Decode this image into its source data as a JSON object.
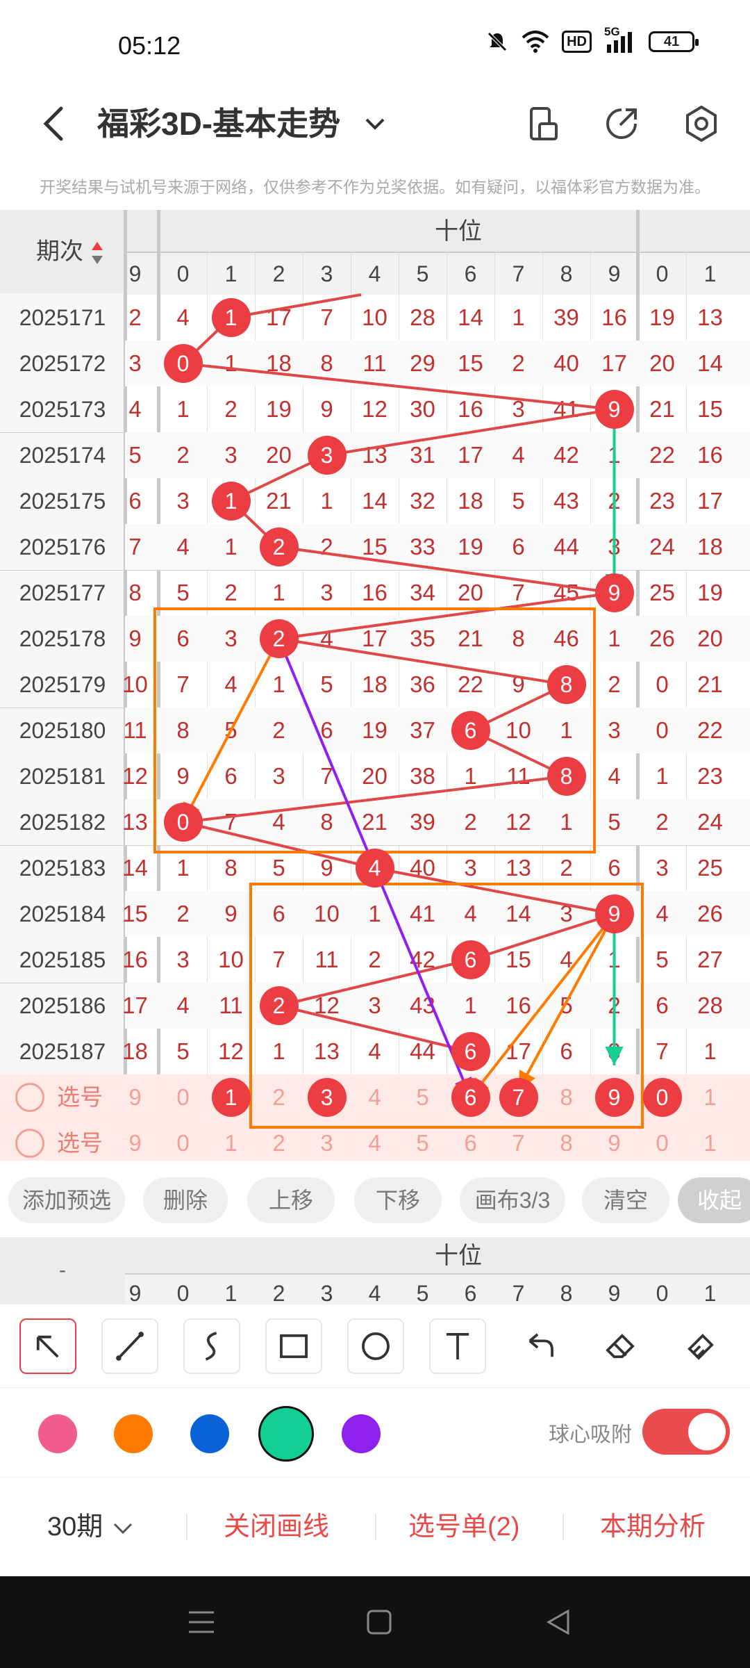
{
  "status": {
    "time": "05:12",
    "battery": "41",
    "hd": "HD",
    "signal": "5G"
  },
  "appbar": {
    "title": "福彩3D-基本走势"
  },
  "notice": "开奖结果与试机号来源于网络，仅供参考不作为兑奖依据。如有疑问，以福体彩官方数据为准。",
  "chart": {
    "period_header": "期次",
    "group_label": "十位",
    "head_digits": [
      "9",
      "0",
      "1",
      "2",
      "3",
      "4",
      "5",
      "6",
      "7",
      "8",
      "9",
      "0",
      "1"
    ],
    "rows": [
      {
        "period": "2025171",
        "cells": [
          "2",
          "4",
          "1",
          "17",
          "7",
          "10",
          "28",
          "14",
          "1",
          "39",
          "16",
          "19",
          "13"
        ],
        "ball": 2
      },
      {
        "period": "2025172",
        "cells": [
          "3",
          "0",
          "1",
          "18",
          "8",
          "11",
          "29",
          "15",
          "2",
          "40",
          "17",
          "20",
          "14"
        ],
        "ball": 1
      },
      {
        "period": "2025173",
        "cells": [
          "4",
          "1",
          "2",
          "19",
          "9",
          "12",
          "30",
          "16",
          "3",
          "41",
          "9",
          "21",
          "15"
        ],
        "ball": 10
      },
      {
        "period": "2025174",
        "cells": [
          "5",
          "2",
          "3",
          "20",
          "3",
          "13",
          "31",
          "17",
          "4",
          "42",
          "1",
          "22",
          "16"
        ],
        "ball": 4
      },
      {
        "period": "2025175",
        "cells": [
          "6",
          "3",
          "1",
          "21",
          "1",
          "14",
          "32",
          "18",
          "5",
          "43",
          "2",
          "23",
          "17"
        ],
        "ball": 2
      },
      {
        "period": "2025176",
        "cells": [
          "7",
          "4",
          "1",
          "2",
          "2",
          "15",
          "33",
          "19",
          "6",
          "44",
          "3",
          "24",
          "18"
        ],
        "ball": 3
      },
      {
        "period": "2025177",
        "cells": [
          "8",
          "5",
          "2",
          "1",
          "3",
          "16",
          "34",
          "20",
          "7",
          "45",
          "9",
          "25",
          "19"
        ],
        "ball": 10
      },
      {
        "period": "2025178",
        "cells": [
          "9",
          "6",
          "3",
          "2",
          "4",
          "17",
          "35",
          "21",
          "8",
          "46",
          "1",
          "26",
          "20"
        ],
        "ball": 3
      },
      {
        "period": "2025179",
        "cells": [
          "10",
          "7",
          "4",
          "1",
          "5",
          "18",
          "36",
          "22",
          "9",
          "8",
          "2",
          "0",
          "21"
        ],
        "ball": 9
      },
      {
        "period": "2025180",
        "cells": [
          "11",
          "8",
          "5",
          "2",
          "6",
          "19",
          "37",
          "6",
          "10",
          "1",
          "3",
          "0",
          "22"
        ],
        "ball": 7
      },
      {
        "period": "2025181",
        "cells": [
          "12",
          "9",
          "6",
          "3",
          "7",
          "20",
          "38",
          "1",
          "11",
          "8",
          "4",
          "1",
          "23"
        ],
        "ball": 9
      },
      {
        "period": "2025182",
        "cells": [
          "13",
          "0",
          "7",
          "4",
          "8",
          "21",
          "39",
          "2",
          "12",
          "1",
          "5",
          "2",
          "24"
        ],
        "ball": 1
      },
      {
        "period": "2025183",
        "cells": [
          "14",
          "1",
          "8",
          "5",
          "9",
          "4",
          "40",
          "3",
          "13",
          "2",
          "6",
          "3",
          "25"
        ],
        "ball": 5
      },
      {
        "period": "2025184",
        "cells": [
          "15",
          "2",
          "9",
          "6",
          "10",
          "1",
          "41",
          "4",
          "14",
          "3",
          "9",
          "4",
          "26"
        ],
        "ball": 10
      },
      {
        "period": "2025185",
        "cells": [
          "16",
          "3",
          "10",
          "7",
          "11",
          "2",
          "42",
          "6",
          "15",
          "4",
          "1",
          "5",
          "27"
        ],
        "ball": 7
      },
      {
        "period": "2025186",
        "cells": [
          "17",
          "4",
          "11",
          "2",
          "12",
          "3",
          "43",
          "1",
          "16",
          "5",
          "2",
          "6",
          "28"
        ],
        "ball": 3
      },
      {
        "period": "2025187",
        "cells": [
          "18",
          "5",
          "12",
          "1",
          "13",
          "4",
          "44",
          "6",
          "17",
          "6",
          "3",
          "7",
          "1"
        ],
        "ball": 7
      }
    ],
    "select_rows": [
      {
        "label": "选号",
        "cells": [
          "9",
          "0",
          "1",
          "2",
          "3",
          "4",
          "5",
          "6",
          "7",
          "8",
          "9",
          "0",
          "1"
        ]
      },
      {
        "label": "选号",
        "cells": [
          "9",
          "0",
          "1",
          "2",
          "3",
          "4",
          "5",
          "6",
          "7",
          "8",
          "9",
          "0",
          "1"
        ]
      }
    ]
  },
  "pills": [
    "添加预选",
    "删除",
    "上移",
    "下移",
    "画布3/3",
    "清空",
    "收起"
  ],
  "tool_icons": [
    "cursor-arrow-icon",
    "line-icon",
    "freehand-icon",
    "rectangle-icon",
    "circle-icon",
    "text-icon",
    "undo-icon",
    "eraser-icon",
    "clear-brush-icon"
  ],
  "colors": [
    "#f25b8f",
    "#ff7a00",
    "#0a63d6",
    "#12cf94",
    "#8f20f0"
  ],
  "snap_label": "球心吸附",
  "bottom": {
    "period_select": "30期",
    "close_lines": "关闭画线",
    "pick_list": "选号单(2)",
    "analysis": "本期分析"
  }
}
